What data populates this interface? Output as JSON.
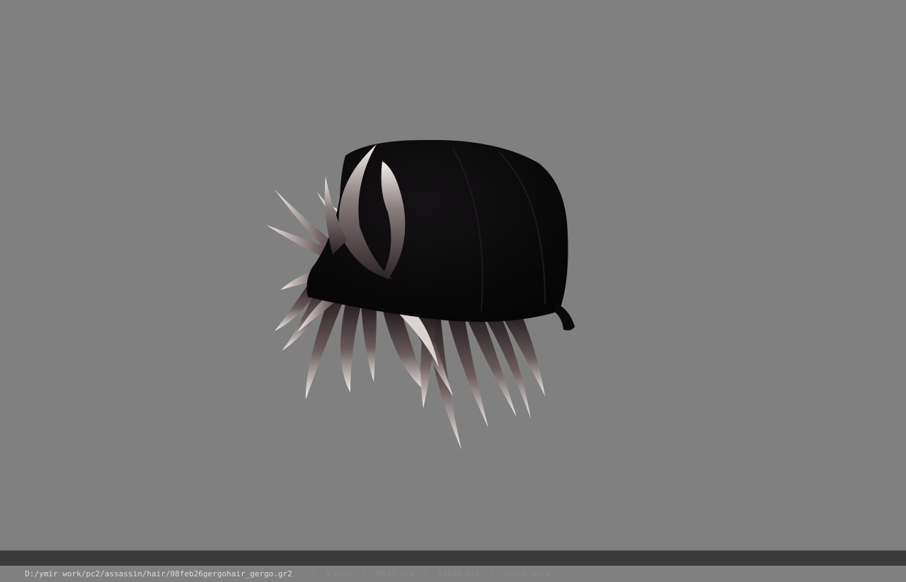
{
  "viewport": {
    "background": "#808080",
    "model_label": "3d-hair-cap-model"
  },
  "status": {
    "file_path": "D:/ymir work/pc2/assassin/hair/08feb26gergohair_gergo.gr2",
    "separator": "|",
    "mesh": "3 mesh",
    "vertices": "8973 vtx",
    "triangles": "14644 tri",
    "anim": "nincs anim"
  }
}
